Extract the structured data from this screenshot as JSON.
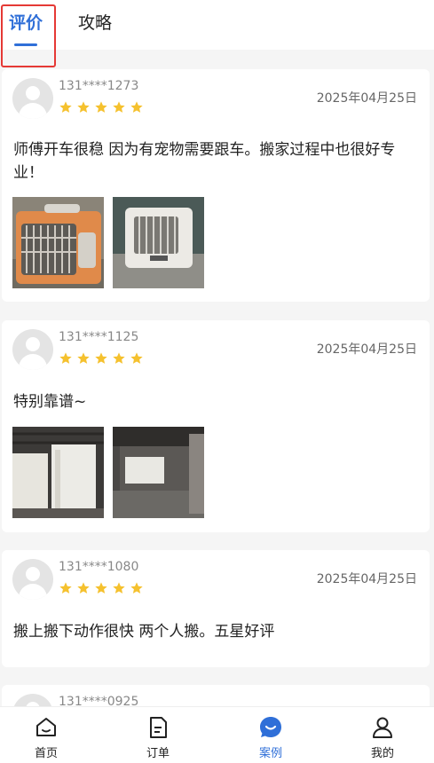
{
  "tabs": {
    "active": "评价",
    "inactive": "攻略"
  },
  "reviews": [
    {
      "user": "131****1273",
      "date": "2025年04月25日",
      "rating": 5,
      "text": "师傅开车很稳 因为有宠物需要跟车。搬家过程中也很好专业！"
    },
    {
      "user": "131****1125",
      "date": "2025年04月25日",
      "rating": 5,
      "text": "特别靠谱~"
    },
    {
      "user": "131****1080",
      "date": "2025年04月25日",
      "rating": 5,
      "text": "搬上搬下动作很快 两个人搬。五星好评"
    },
    {
      "user": "131****0925"
    }
  ],
  "tabbar": {
    "home": "首页",
    "orders": "订单",
    "cases": "案例",
    "mine": "我的"
  },
  "colors": {
    "accent": "#2f6fd8",
    "star": "#f5c12e",
    "highlight": "#e53935"
  },
  "icons": {
    "home": "home-icon",
    "orders": "document-icon",
    "cases": "chat-bubble-icon",
    "mine": "user-icon"
  }
}
